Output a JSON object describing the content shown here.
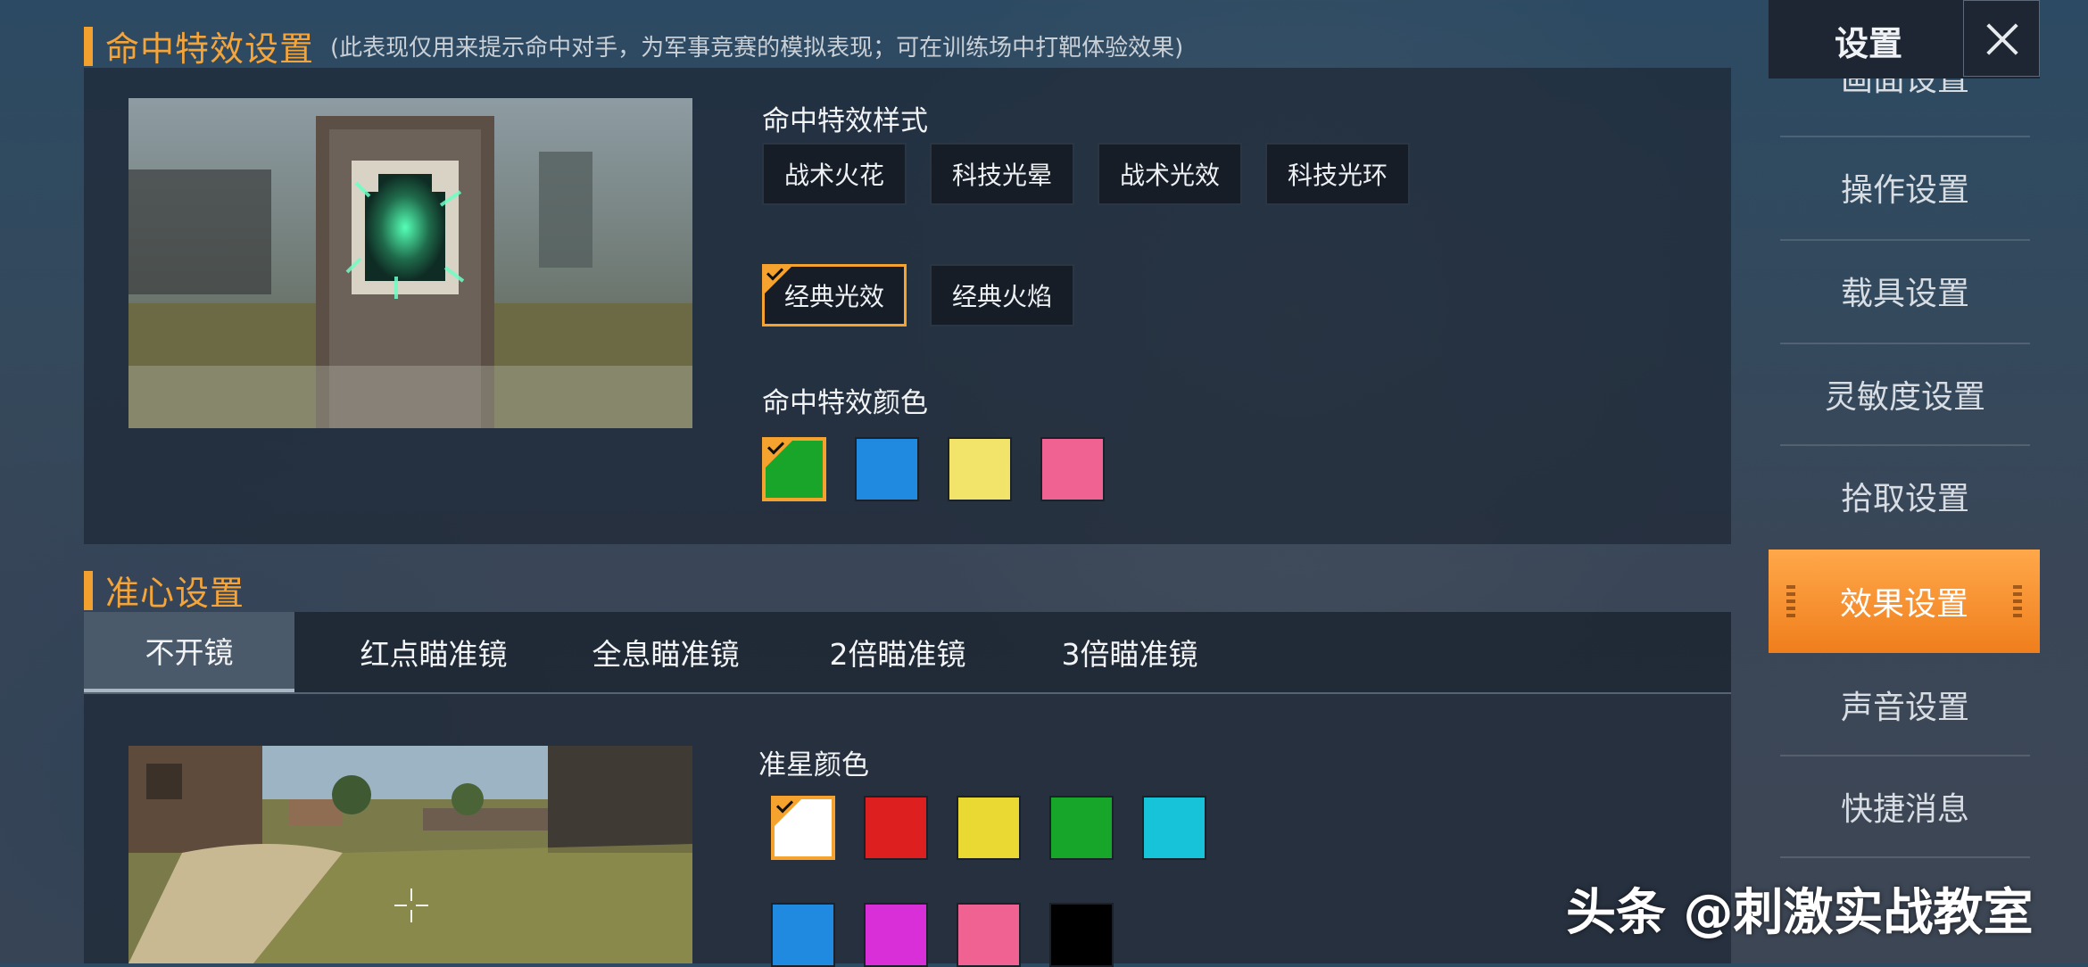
{
  "hit_effect": {
    "title": "命中特效设置",
    "note": "(此表现仅用来提示命中对手，为军事竞赛的模拟表现；可在训练场中打靶体验效果)",
    "style_label": "命中特效样式",
    "styles": [
      "战术火花",
      "科技光晕",
      "战术光效",
      "科技光环",
      "经典光效",
      "经典火焰"
    ],
    "selected_style": "经典光效",
    "color_label": "命中特效颜色",
    "colors": [
      "#19a52a",
      "#1f8ae0",
      "#f2e46a",
      "#f06292"
    ],
    "selected_color_index": 0
  },
  "crosshair": {
    "title": "准心设置",
    "tabs": [
      "不开镜",
      "红点瞄准镜",
      "全息瞄准镜",
      "2倍瞄准镜",
      "3倍瞄准镜"
    ],
    "active_tab": "不开镜",
    "color_label": "准星颜色",
    "colors": [
      "#ffffff",
      "#dd1f1f",
      "#e9d932",
      "#17a52a",
      "#16c3d8",
      "#1f8ae0",
      "#d82fd8",
      "#f06292",
      "#000000"
    ],
    "selected_color_index": 0
  },
  "sidebar": {
    "title": "设置",
    "items": [
      "画面设置",
      "操作设置",
      "载具设置",
      "灵敏度设置",
      "拾取设置",
      "效果设置",
      "声音设置",
      "快捷消息"
    ],
    "active_item": "效果设置"
  },
  "watermark": "头条 @刺激实战教室"
}
